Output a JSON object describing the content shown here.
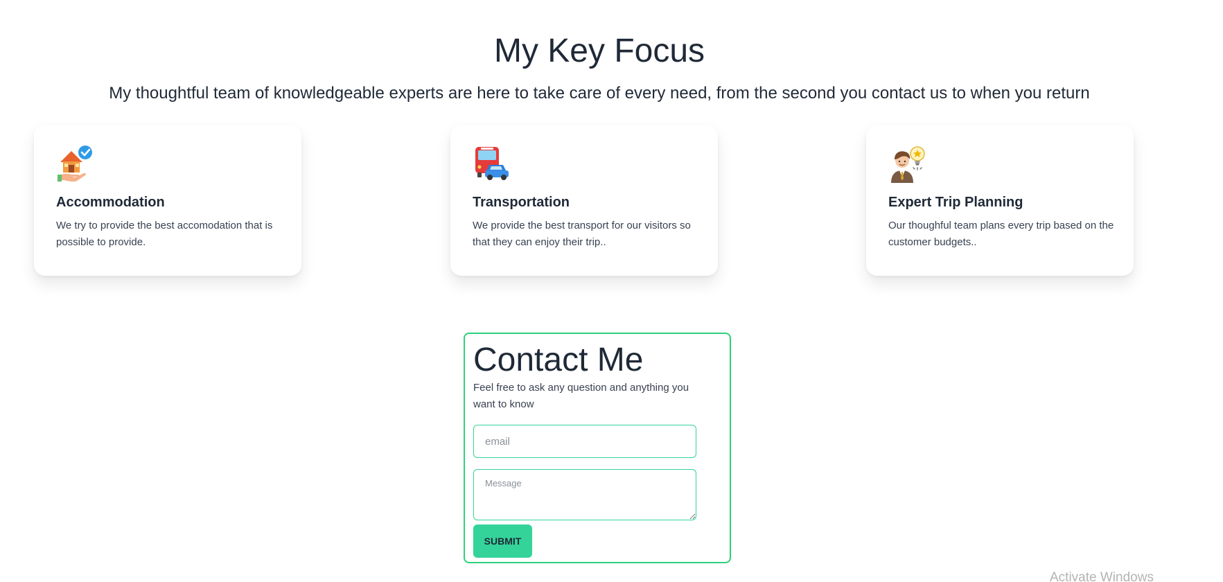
{
  "focus": {
    "title": "My Key Focus",
    "subtitle": "My thoughtful team of knowledgeable experts are here to take care of every need, from the second you contact us to when you return"
  },
  "cards": [
    {
      "icon": "house-check-icon",
      "title": "Accommodation",
      "text": "We try to provide the best accomodation that is possible to provide."
    },
    {
      "icon": "bus-car-icon",
      "title": "Transportation",
      "text": "We provide the best transport for our visitors so that they can enjoy their trip.."
    },
    {
      "icon": "expert-idea-icon",
      "title": "Expert Trip Planning",
      "text": "Our thoughful team plans every trip based on the customer budgets.."
    }
  ],
  "contact": {
    "title": "Contact Me",
    "text": "Feel free to ask any question and anything you want to know",
    "email_placeholder": "email",
    "email_value": "",
    "message_placeholder": "Message",
    "message_value": "",
    "submit_label": "SUBMIT"
  },
  "watermark": "Activate Windows",
  "colors": {
    "accent": "#34d399",
    "border_accent": "#2ed07a",
    "text": "#1f2937"
  }
}
